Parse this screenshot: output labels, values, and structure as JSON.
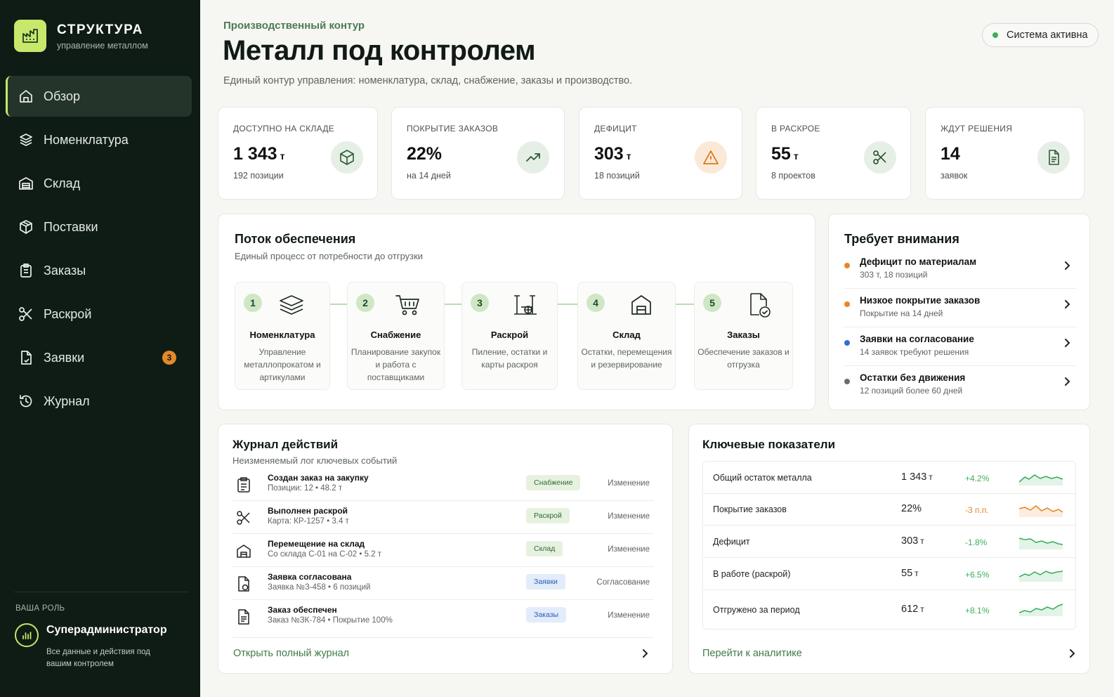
{
  "brand": {
    "title": "СТРУКТУРА",
    "subtitle": "управление металлом",
    "accent": "#c7e86a"
  },
  "nav": {
    "items": [
      {
        "label": "Обзор",
        "icon": "home-icon",
        "active": true
      },
      {
        "label": "Номенклатура",
        "icon": "layers-icon"
      },
      {
        "label": "Склад",
        "icon": "warehouse-icon"
      },
      {
        "label": "Поставки",
        "icon": "box-icon"
      },
      {
        "label": "Заказы",
        "icon": "clipboard-icon"
      },
      {
        "label": "Раскрой",
        "icon": "scissors-icon"
      },
      {
        "label": "Заявки",
        "icon": "file-icon",
        "badge": "3"
      },
      {
        "label": "Журнал",
        "icon": "history-icon"
      }
    ]
  },
  "role": {
    "label": "ВАША РОЛЬ",
    "name": "Суперадминистратор",
    "desc": "Все данные и действия под вашим контролем"
  },
  "header": {
    "eyebrow": "Производственный контур",
    "title": "Металл под контролем",
    "subtitle": "Единый контур управления: номенклатура, склад, снабжение, заказы и производство.",
    "status": "Система активна",
    "status_color": "#3fae5c"
  },
  "kpis": [
    {
      "label": "ДОСТУПНО НА СКЛАДЕ",
      "value": "1 343",
      "unit": "т",
      "sub": "192 позиции",
      "icon": "cube-icon"
    },
    {
      "label": "ПОКРЫТИЕ ЗАКАЗОВ",
      "value": "22%",
      "unit": "",
      "sub": "на 14 дней",
      "icon": "trend-up-icon"
    },
    {
      "label": "ДЕФИЦИТ",
      "value": "303",
      "unit": "т",
      "sub": "18 позиций",
      "icon": "warning-icon"
    },
    {
      "label": "В РАСКРОЕ",
      "value": "55",
      "unit": "т",
      "sub": "8 проектов",
      "icon": "scissors-icon"
    },
    {
      "label": "ЖДУТ РЕШЕНИЯ",
      "value": "14",
      "unit": "",
      "sub": "заявок",
      "icon": "document-icon"
    }
  ],
  "flow": {
    "title": "Поток обеспечения",
    "subtitle": "Единый процесс от потребности до отгрузки",
    "steps": [
      {
        "num": "1",
        "name": "Номенклатура",
        "desc": "Управление металлопрокатом и артикулами",
        "icon": "layers-icon"
      },
      {
        "num": "2",
        "name": "Снабжение",
        "desc": "Планирование закупок и работа с поставщиками",
        "icon": "cart-icon"
      },
      {
        "num": "3",
        "name": "Раскрой",
        "desc": "Пиление, остатки и карты раскроя",
        "icon": "saw-icon"
      },
      {
        "num": "4",
        "name": "Склад",
        "desc": "Остатки, перемещения и резервирование",
        "icon": "warehouse-icon"
      },
      {
        "num": "5",
        "name": "Заказы",
        "desc": "Обеспечение заказов и отгрузка",
        "icon": "file-check-icon"
      }
    ]
  },
  "attention": {
    "title": "Требует внимания",
    "items": [
      {
        "title": "Дефицит по материалам",
        "sub": "303 т, 18 позиций",
        "color": "#e8862a"
      },
      {
        "title": "Низкое покрытие заказов",
        "sub": "Покрытие на 14 дней",
        "color": "#e8862a"
      },
      {
        "title": "Заявки на согласование",
        "sub": "14 заявок требуют решения",
        "color": "#2f6fd6"
      },
      {
        "title": "Остатки без движения",
        "sub": "12 позиций более 60 дней",
        "color": "#6b6f6c"
      }
    ]
  },
  "journal": {
    "title": "Журнал действий",
    "subtitle": "Неизменяемый лог ключевых событий",
    "rows": [
      {
        "title": "Создан заказ на закупку",
        "sub": "Позиции: 12  •  48.2 т",
        "tag": "Снабжение",
        "tag_kind": "green",
        "action": "Изменение",
        "icon": "clipboard-icon"
      },
      {
        "title": "Выполнен раскрой",
        "sub": "Карта: КР-1257  •  3.4 т",
        "tag": "Раскрой",
        "tag_kind": "green",
        "action": "Изменение",
        "icon": "scissors-icon"
      },
      {
        "title": "Перемещение на склад",
        "sub": "Со склада С-01 на С-02  •  5.2 т",
        "tag": "Склад",
        "tag_kind": "green",
        "action": "Изменение",
        "icon": "warehouse-icon"
      },
      {
        "title": "Заявка согласована",
        "sub": "Заявка №З-458  •  6 позиций",
        "tag": "Заявки",
        "tag_kind": "blue",
        "action": "Согласование",
        "icon": "file-icon"
      },
      {
        "title": "Заказ обеспечен",
        "sub": "Заказ №ЗК-784  •  Покрытие 100%",
        "tag": "Заказы",
        "tag_kind": "blue",
        "action": "Изменение",
        "icon": "document-icon"
      }
    ],
    "link": "Открыть полный журнал"
  },
  "metrics": {
    "title": "Ключевые показатели",
    "rows": [
      {
        "name": "Общий остаток металла",
        "value": "1 343",
        "unit": "т",
        "delta": "+4.2%",
        "trend": "up",
        "color": "#3fae5c"
      },
      {
        "name": "Покрытие заказов",
        "value": "22%",
        "unit": "",
        "delta": "-3 п.п.",
        "trend": "down",
        "color": "#e8862a"
      },
      {
        "name": "Дефицит",
        "value": "303",
        "unit": "т",
        "delta": "-1.8%",
        "trend": "down",
        "color": "#3fae5c"
      },
      {
        "name": "В работе (раскрой)",
        "value": "55",
        "unit": "т",
        "delta": "+6.5%",
        "trend": "up",
        "color": "#3fae5c"
      },
      {
        "name": "Отгружено за период",
        "value": "612",
        "unit": "т",
        "delta": "+8.1%",
        "trend": "up",
        "color": "#3fae5c"
      }
    ],
    "link": "Перейти к аналитике"
  }
}
